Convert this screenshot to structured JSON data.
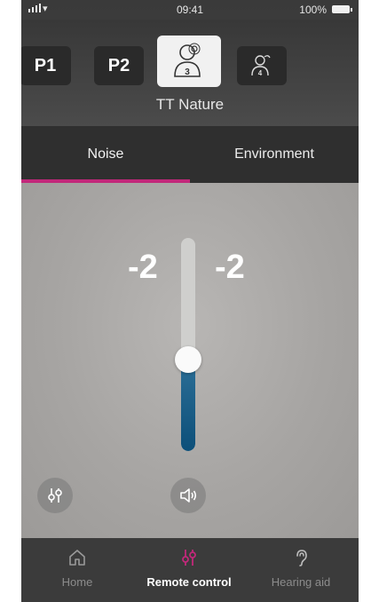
{
  "status_bar": {
    "time": "09:41",
    "battery": "100%"
  },
  "programs": [
    {
      "label": "P1"
    },
    {
      "label": "P2"
    },
    {
      "label": "3",
      "icon": "person-listening-icon",
      "active": true
    },
    {
      "label": "4",
      "icon": "person-speech-icon"
    }
  ],
  "program_name": "TT Nature",
  "tabs": [
    {
      "label": "Noise",
      "active": true
    },
    {
      "label": "Environment",
      "active": false
    }
  ],
  "noise": {
    "left_value": "-2",
    "right_value": "-2",
    "slider_level": 0.43
  },
  "buttons": {
    "equalizer_icon": "equalizer-icon",
    "volume_icon": "speaker-icon"
  },
  "bottom_nav": [
    {
      "label": "Home",
      "icon": "home-icon"
    },
    {
      "label": "Remote control",
      "icon": "sliders-icon",
      "active": true
    },
    {
      "label": "Hearing aid",
      "icon": "ear-icon"
    }
  ],
  "colors": {
    "accent": "#c2287a",
    "slider_fill": "#0d4f79",
    "background_dark": "#2f2f2f"
  }
}
